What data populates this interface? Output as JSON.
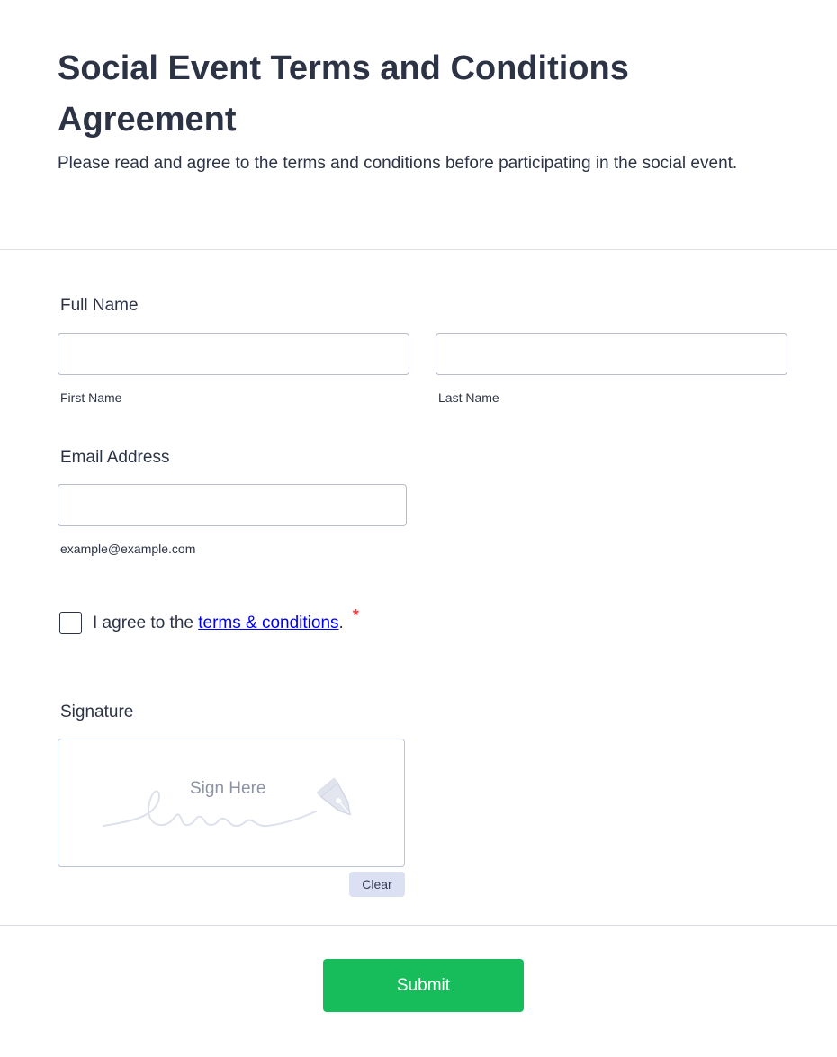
{
  "form": {
    "title": "Social Event Terms and Conditions Agreement",
    "subtitle": "Please read and agree to the terms and conditions before participating in the social event."
  },
  "full_name": {
    "label": "Full Name",
    "first": {
      "sublabel": "First Name",
      "value": "",
      "placeholder": ""
    },
    "last": {
      "sublabel": "Last Name",
      "value": "",
      "placeholder": ""
    }
  },
  "email": {
    "label": "Email Address",
    "value": "",
    "placeholder": "",
    "sublabel": "example@example.com"
  },
  "agreement": {
    "prefix": "I agree to the ",
    "link_text": "terms & conditions",
    "suffix": ".",
    "required_mark": "*",
    "checked": false
  },
  "signature": {
    "label": "Signature",
    "placeholder": "Sign Here",
    "clear_label": "Clear",
    "icons": [
      "signature-scribble-icon",
      "pen-nib-icon"
    ]
  },
  "submit": {
    "label": "Submit",
    "color": "#18bd5b"
  },
  "colors": {
    "text": "#2c3345",
    "link": "#0000ee",
    "required": "#f23a3c",
    "clear_button_bg": "#dbe0f3"
  }
}
